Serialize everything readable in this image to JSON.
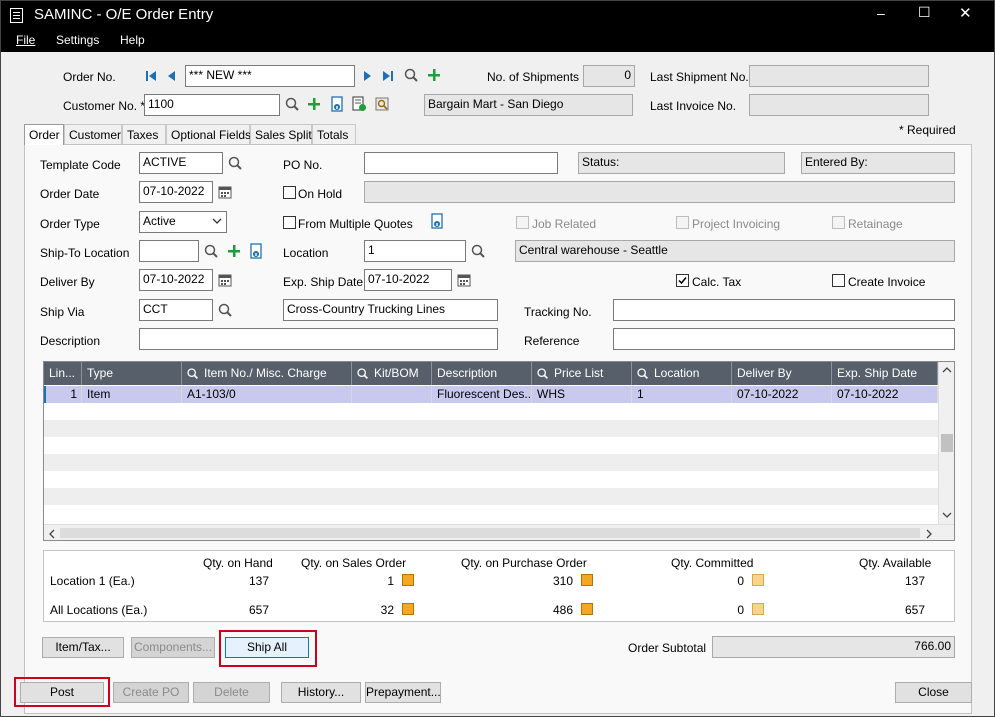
{
  "window": {
    "title": "SAMINC - O/E Order Entry",
    "minimize_glyph": "–",
    "maximize_glyph": "☐",
    "close_glyph": "✕"
  },
  "menu": [
    "File",
    "Settings",
    "Help"
  ],
  "header": {
    "order_no_label": "Order No.",
    "order_no_value": "*** NEW ***",
    "shipments_label": "No. of Shipments",
    "shipments_value": "0",
    "last_shipment_label": "Last Shipment No.",
    "last_shipment_value": "",
    "customer_no_label": "Customer No. *",
    "customer_no_value": "1100",
    "customer_name": "Bargain Mart - San Diego",
    "last_invoice_label": "Last Invoice No.",
    "last_invoice_value": "",
    "required_note": "*  Required"
  },
  "tabs": [
    "Order",
    "Customer",
    "Taxes",
    "Optional Fields",
    "Sales Split",
    "Totals"
  ],
  "form": {
    "template_code_label": "Template Code",
    "template_code_value": "ACTIVE",
    "po_no_label": "PO No.",
    "po_no_value": "",
    "status_label": "Status:",
    "entered_by_label": "Entered By:",
    "order_date_label": "Order Date",
    "order_date_value": "07-10-2022",
    "on_hold_label": "On Hold",
    "on_hold_reason": "",
    "order_type_label": "Order Type",
    "order_type_value": "Active",
    "from_quotes_label": "From Multiple Quotes",
    "job_related_label": "Job Related",
    "project_invoicing_label": "Project Invoicing",
    "retainage_label": "Retainage",
    "ship_to_label": "Ship-To Location",
    "ship_to_value": "",
    "location_label": "Location",
    "location_value": "1",
    "location_desc": "Central warehouse - Seattle",
    "deliver_by_label": "Deliver By",
    "deliver_by_value": "07-10-2022",
    "exp_ship_label": "Exp. Ship Date",
    "exp_ship_value": "07-10-2022",
    "calc_tax_label": "Calc. Tax",
    "calc_tax_checked": true,
    "create_invoice_label": "Create Invoice",
    "ship_via_label": "Ship Via",
    "ship_via_value": "CCT",
    "ship_via_desc": "Cross-Country Trucking Lines",
    "tracking_label": "Tracking No.",
    "tracking_value": "",
    "description_label": "Description",
    "description_value": "",
    "reference_label": "Reference",
    "reference_value": ""
  },
  "grid": {
    "columns": [
      "Lin...",
      "Type",
      "Item No./ Misc. Charge",
      "Kit/BOM",
      "Description",
      "Price List",
      "Location",
      "Deliver By",
      "Exp. Ship Date"
    ],
    "rows": [
      [
        "1",
        "Item",
        "A1-103/0",
        "",
        "Fluorescent Des...",
        "WHS",
        "1",
        "07-10-2022",
        "07-10-2022"
      ]
    ]
  },
  "quantities": {
    "headers": [
      "Qty. on Hand",
      "Qty. on Sales Order",
      "Qty. on Purchase Order",
      "Qty. Committed",
      "Qty. Available"
    ],
    "rows": [
      {
        "label": "Location  1 (Ea.)",
        "values": [
          "137",
          "1",
          "310",
          "0",
          "137"
        ]
      },
      {
        "label": "All Locations (Ea.)",
        "values": [
          "657",
          "32",
          "486",
          "0",
          "657"
        ]
      }
    ]
  },
  "buttons": {
    "item_tax": "Item/Tax...",
    "components": "Components...",
    "ship_all": "Ship All",
    "order_subtotal_label": "Order Subtotal",
    "order_subtotal_value": "766.00",
    "post": "Post",
    "create_po": "Create PO",
    "delete": "Delete",
    "history": "History...",
    "prepayment": "Prepayment...",
    "close": "Close"
  },
  "colors": {
    "highlight_box": "#d0021b",
    "grid_header": "#575f6a",
    "selected_row": "#c9c9f0",
    "add_icon": "#1e9e3a",
    "nav_icon": "#1f6fb5"
  }
}
